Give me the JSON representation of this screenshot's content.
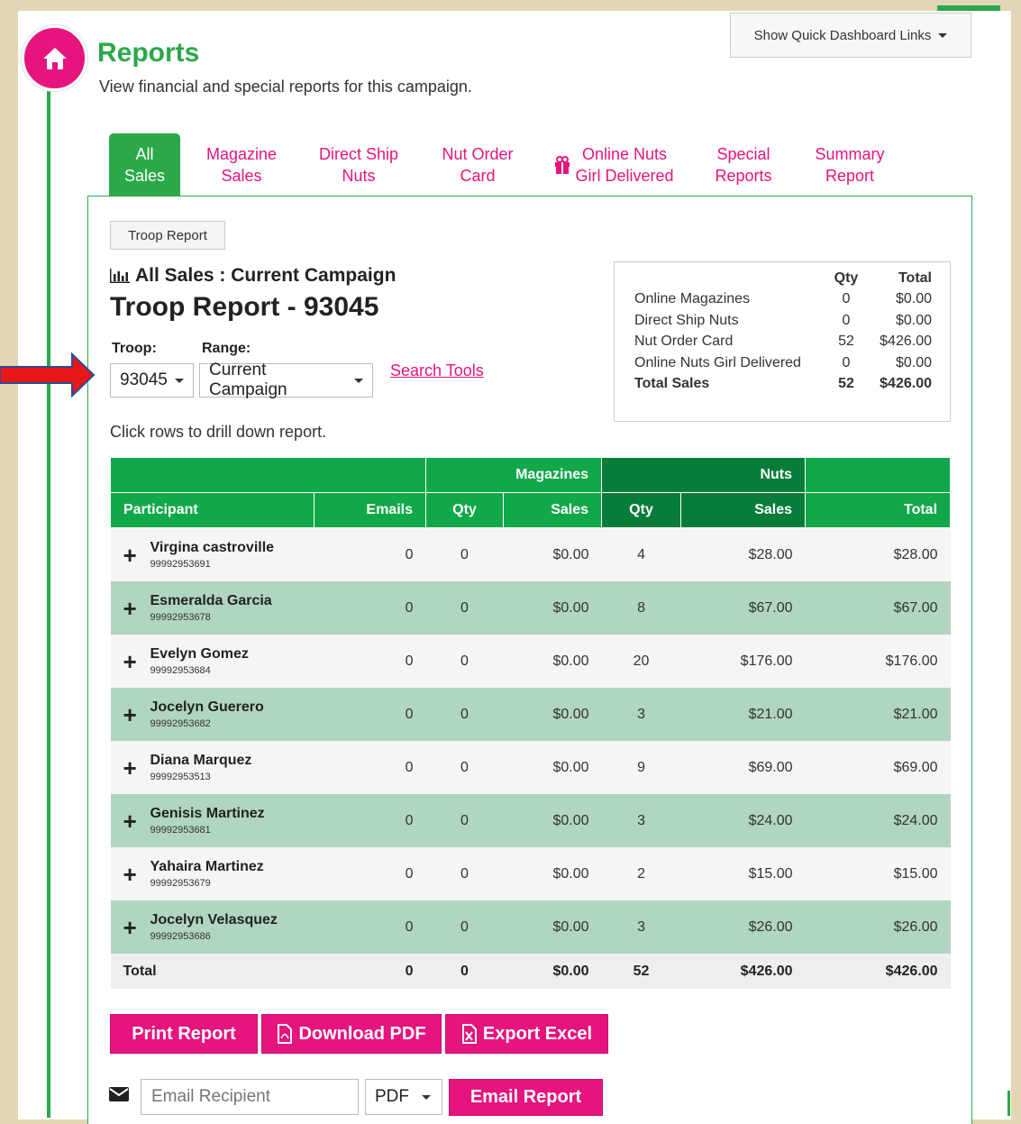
{
  "header": {
    "title": "Reports",
    "subtitle": "View financial and special reports for this campaign.",
    "quick_links": "Show Quick Dashboard Links"
  },
  "tabs": [
    {
      "label_line1": "All",
      "label_line2": "Sales",
      "active": true
    },
    {
      "label_line1": "Magazine",
      "label_line2": "Sales"
    },
    {
      "label_line1": "Direct Ship",
      "label_line2": "Nuts"
    },
    {
      "label_line1": "Nut Order",
      "label_line2": "Card"
    },
    {
      "label_line1": "Online Nuts",
      "label_line2": "Girl Delivered",
      "icon": "gift-icon"
    },
    {
      "label_line1": "Special",
      "label_line2": "Reports"
    },
    {
      "label_line1": "Summary",
      "label_line2": "Report"
    }
  ],
  "report": {
    "troop_report_button": "Troop Report",
    "section_title": "All Sales : Current Campaign",
    "title": "Troop Report - 93045",
    "troop_label": "Troop:",
    "troop_value": "93045",
    "range_label": "Range:",
    "range_value": "Current Campaign",
    "search_tools": "Search Tools",
    "hint": "Click rows to drill down report."
  },
  "summary": {
    "headers": {
      "qty": "Qty",
      "total": "Total"
    },
    "rows": [
      {
        "label": "Online Magazines",
        "qty": "0",
        "total": "$0.00"
      },
      {
        "label": "Direct Ship Nuts",
        "qty": "0",
        "total": "$0.00"
      },
      {
        "label": "Nut Order Card",
        "qty": "52",
        "total": "$426.00"
      },
      {
        "label": "Online Nuts Girl Delivered",
        "qty": "0",
        "total": "$0.00"
      }
    ],
    "total": {
      "label": "Total Sales",
      "qty": "52",
      "total": "$426.00"
    }
  },
  "table": {
    "group_headers": {
      "magazines": "Magazines",
      "nuts": "Nuts"
    },
    "headers": {
      "participant": "Participant",
      "emails": "Emails",
      "mag_qty": "Qty",
      "mag_sales": "Sales",
      "nut_qty": "Qty",
      "nut_sales": "Sales",
      "total": "Total"
    },
    "rows": [
      {
        "name": "Virgina castroville",
        "id": "99992953691",
        "emails": "0",
        "mag_qty": "0",
        "mag_sales": "$0.00",
        "nut_qty": "4",
        "nut_sales": "$28.00",
        "total": "$28.00"
      },
      {
        "name": "Esmeralda Garcia",
        "id": "99992953678",
        "emails": "0",
        "mag_qty": "0",
        "mag_sales": "$0.00",
        "nut_qty": "8",
        "nut_sales": "$67.00",
        "total": "$67.00"
      },
      {
        "name": "Evelyn Gomez",
        "id": "99992953684",
        "emails": "0",
        "mag_qty": "0",
        "mag_sales": "$0.00",
        "nut_qty": "20",
        "nut_sales": "$176.00",
        "total": "$176.00"
      },
      {
        "name": "Jocelyn Guerero",
        "id": "99992953682",
        "emails": "0",
        "mag_qty": "0",
        "mag_sales": "$0.00",
        "nut_qty": "3",
        "nut_sales": "$21.00",
        "total": "$21.00"
      },
      {
        "name": "Diana Marquez",
        "id": "99992953513",
        "emails": "0",
        "mag_qty": "0",
        "mag_sales": "$0.00",
        "nut_qty": "9",
        "nut_sales": "$69.00",
        "total": "$69.00"
      },
      {
        "name": "Genisis Martinez",
        "id": "99992953681",
        "emails": "0",
        "mag_qty": "0",
        "mag_sales": "$0.00",
        "nut_qty": "3",
        "nut_sales": "$24.00",
        "total": "$24.00"
      },
      {
        "name": "Yahaira Martinez",
        "id": "99992953679",
        "emails": "0",
        "mag_qty": "0",
        "mag_sales": "$0.00",
        "nut_qty": "2",
        "nut_sales": "$15.00",
        "total": "$15.00"
      },
      {
        "name": "Jocelyn Velasquez",
        "id": "99992953686",
        "emails": "0",
        "mag_qty": "0",
        "mag_sales": "$0.00",
        "nut_qty": "3",
        "nut_sales": "$26.00",
        "total": "$26.00"
      }
    ],
    "footer": {
      "label": "Total",
      "emails": "0",
      "mag_qty": "0",
      "mag_sales": "$0.00",
      "nut_qty": "52",
      "nut_sales": "$426.00",
      "total": "$426.00"
    }
  },
  "actions": {
    "print": "Print Report",
    "download_pdf": "Download PDF",
    "export_excel": "Export Excel",
    "email_placeholder": "Email Recipient",
    "format_value": "PDF",
    "email_report": "Email Report"
  },
  "colors": {
    "brand_green": "#2ba84a",
    "accent_pink": "#e5147e",
    "dark_green": "#087d39",
    "row_green": "#b0d5c0"
  }
}
